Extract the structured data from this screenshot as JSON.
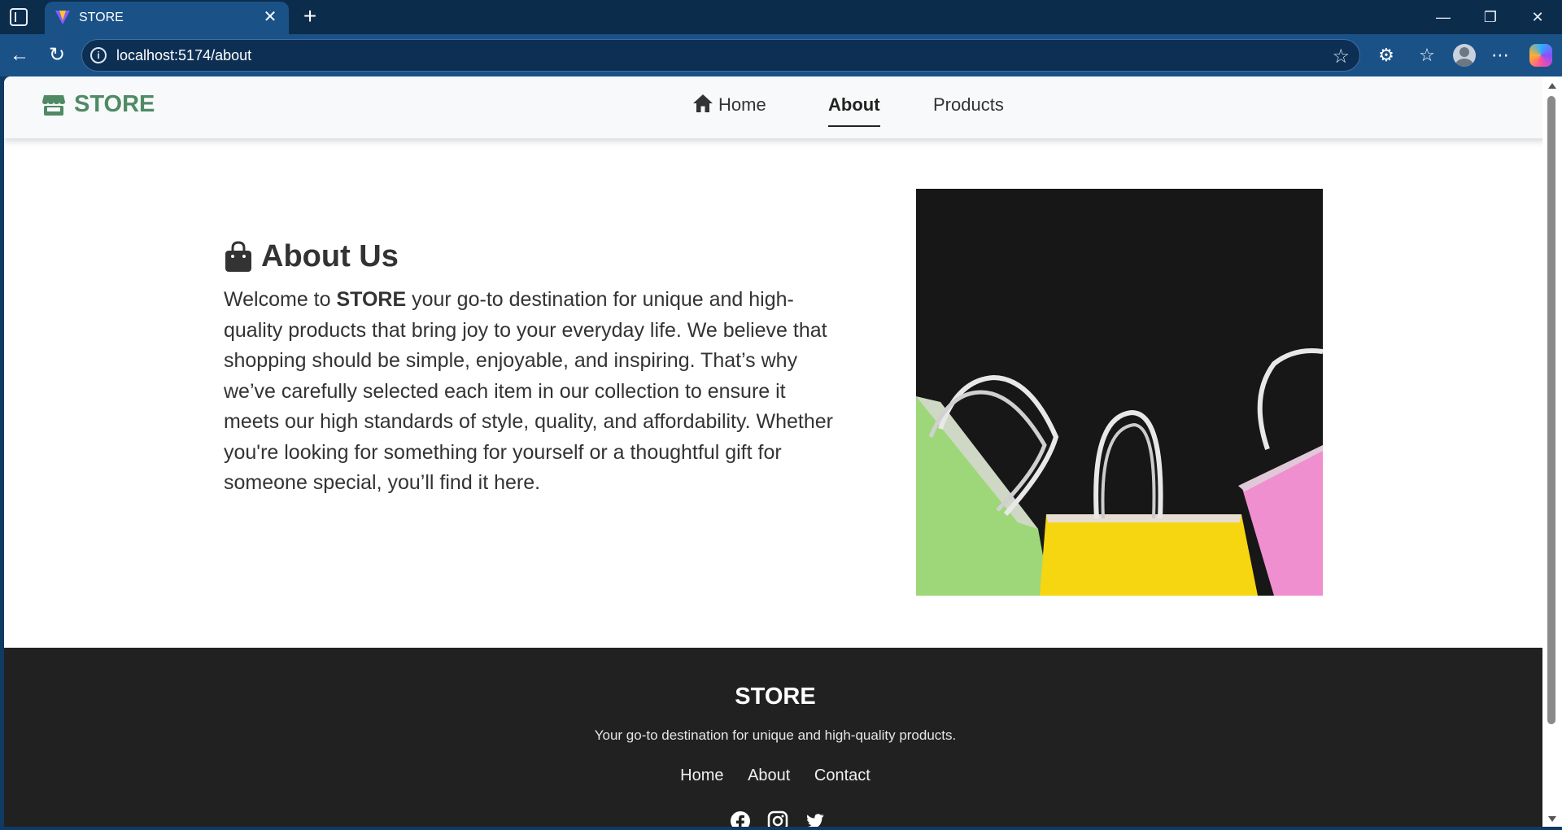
{
  "browser": {
    "tab_title": "STORE",
    "url": "localhost:5174/about",
    "new_tab_symbol": "+",
    "close_symbol": "✕"
  },
  "site": {
    "brand": "STORE",
    "brand_color": "#4f8a64",
    "nav": {
      "home": "Home",
      "about": "About",
      "products": "Products"
    }
  },
  "about": {
    "heading": "About Us",
    "intro_before": "Welcome to ",
    "intro_brand": "STORE",
    "intro_after": " your go-to destination for unique and high-quality products that bring joy to your everyday life. We believe that shopping should be simple, enjoyable, and inspiring. That’s why we’ve carefully selected each item in our collection to ensure it meets our high standards of style, quality, and affordability. Whether you're looking for something for yourself or a thoughtful gift for someone special, you’ll find it here."
  },
  "footer": {
    "title": "STORE",
    "tagline": "Your go-to destination for unique and high-quality products.",
    "links": {
      "home": "Home",
      "about": "About",
      "contact": "Contact"
    },
    "social_icons": [
      "facebook-icon",
      "instagram-icon",
      "twitter-icon"
    ]
  }
}
